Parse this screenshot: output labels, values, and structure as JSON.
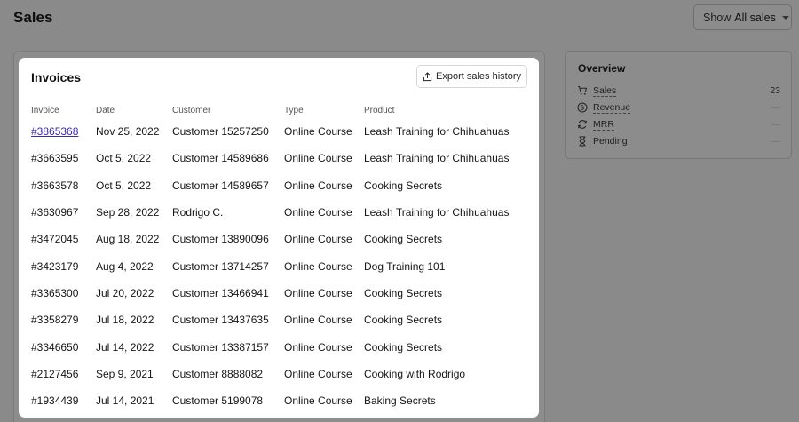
{
  "page": {
    "title": "Sales"
  },
  "filter": {
    "prefix": "Show",
    "value": "All sales"
  },
  "invoices": {
    "title": "Invoices",
    "export_label": "Export sales history",
    "columns": [
      "Invoice",
      "Date",
      "Customer",
      "Type",
      "Product"
    ],
    "rows": [
      {
        "invoice": "#3865368",
        "date": "Nov 25, 2022",
        "customer": "Customer 15257250",
        "type": "Online Course",
        "product": "Leash Training for Chihuahuas"
      },
      {
        "invoice": "#3663595",
        "date": "Oct 5, 2022",
        "customer": "Customer 14589686",
        "type": "Online Course",
        "product": "Leash Training for Chihuahuas"
      },
      {
        "invoice": "#3663578",
        "date": "Oct 5, 2022",
        "customer": "Customer 14589657",
        "type": "Online Course",
        "product": "Cooking Secrets"
      },
      {
        "invoice": "#3630967",
        "date": "Sep 28, 2022",
        "customer": "Rodrigo C.",
        "type": "Online Course",
        "product": "Leash Training for Chihuahuas"
      },
      {
        "invoice": "#3472045",
        "date": "Aug 18, 2022",
        "customer": "Customer 13890096",
        "type": "Online Course",
        "product": "Cooking Secrets"
      },
      {
        "invoice": "#3423179",
        "date": "Aug 4, 2022",
        "customer": "Customer 13714257",
        "type": "Online Course",
        "product": "Dog Training 101"
      },
      {
        "invoice": "#3365300",
        "date": "Jul 20, 2022",
        "customer": "Customer 13466941",
        "type": "Online Course",
        "product": "Cooking Secrets"
      },
      {
        "invoice": "#3358279",
        "date": "Jul 18, 2022",
        "customer": "Customer 13437635",
        "type": "Online Course",
        "product": "Cooking Secrets"
      },
      {
        "invoice": "#3346650",
        "date": "Jul 14, 2022",
        "customer": "Customer 13387157",
        "type": "Online Course",
        "product": "Cooking Secrets"
      },
      {
        "invoice": "#2127456",
        "date": "Sep 9, 2021",
        "customer": "Customer 8888082",
        "type": "Online Course",
        "product": "Cooking with Rodrigo"
      },
      {
        "invoice": "#1934439",
        "date": "Jul 14, 2021",
        "customer": "Customer 5199078",
        "type": "Online Course",
        "product": "Baking Secrets"
      }
    ]
  },
  "overview": {
    "title": "Overview",
    "items": [
      {
        "label": "Sales",
        "value": "23",
        "icon": "cart-icon"
      },
      {
        "label": "Revenue",
        "value": "",
        "icon": "dollar-circle-icon"
      },
      {
        "label": "MRR",
        "value": "",
        "icon": "refresh-icon"
      },
      {
        "label": "Pending",
        "value": "",
        "icon": "hourglass-icon"
      }
    ]
  },
  "colors": {
    "link": "#3b2bb0",
    "overlay": "#8a8a8a"
  }
}
